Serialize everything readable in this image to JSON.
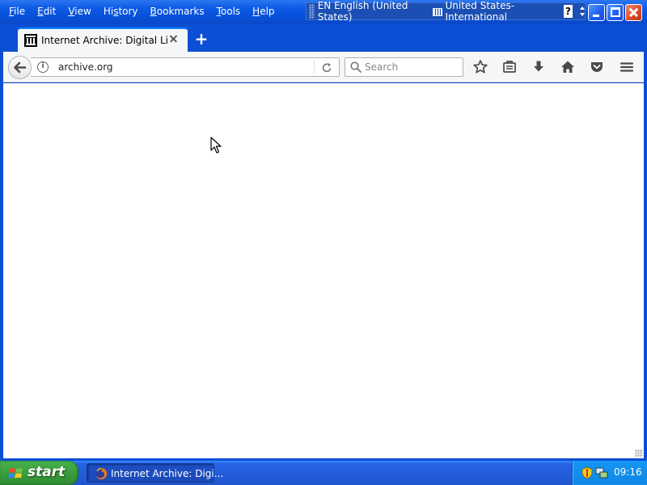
{
  "menubar": {
    "items": [
      {
        "accel": "F",
        "rest": "ile"
      },
      {
        "accel": "E",
        "rest": "dit"
      },
      {
        "accel": "V",
        "rest": "iew"
      },
      {
        "accel": "",
        "pre": "Hi",
        "accel2": "s",
        "rest": "tory"
      },
      {
        "accel": "B",
        "rest": "ookmarks"
      },
      {
        "accel": "T",
        "rest": "ools"
      },
      {
        "accel": "H",
        "rest": "elp"
      }
    ]
  },
  "language_bar": {
    "language": "EN English (United States)",
    "keyboard_layout": "United States-International",
    "help_label": "?"
  },
  "tab": {
    "title": "Internet Archive: Digital Libra...",
    "favicon": "archive-building-icon"
  },
  "newtab_label": "+",
  "navbar": {
    "url": "archive.org",
    "search_placeholder": "Search"
  },
  "taskbar": {
    "start_label": "start",
    "task_title": "Internet Archive: Digi...",
    "clock": "09:16"
  },
  "colors": {
    "xp_blue": "#0a4ed6",
    "start_green": "#3c9f3e",
    "tray_blue": "#1496f4"
  }
}
